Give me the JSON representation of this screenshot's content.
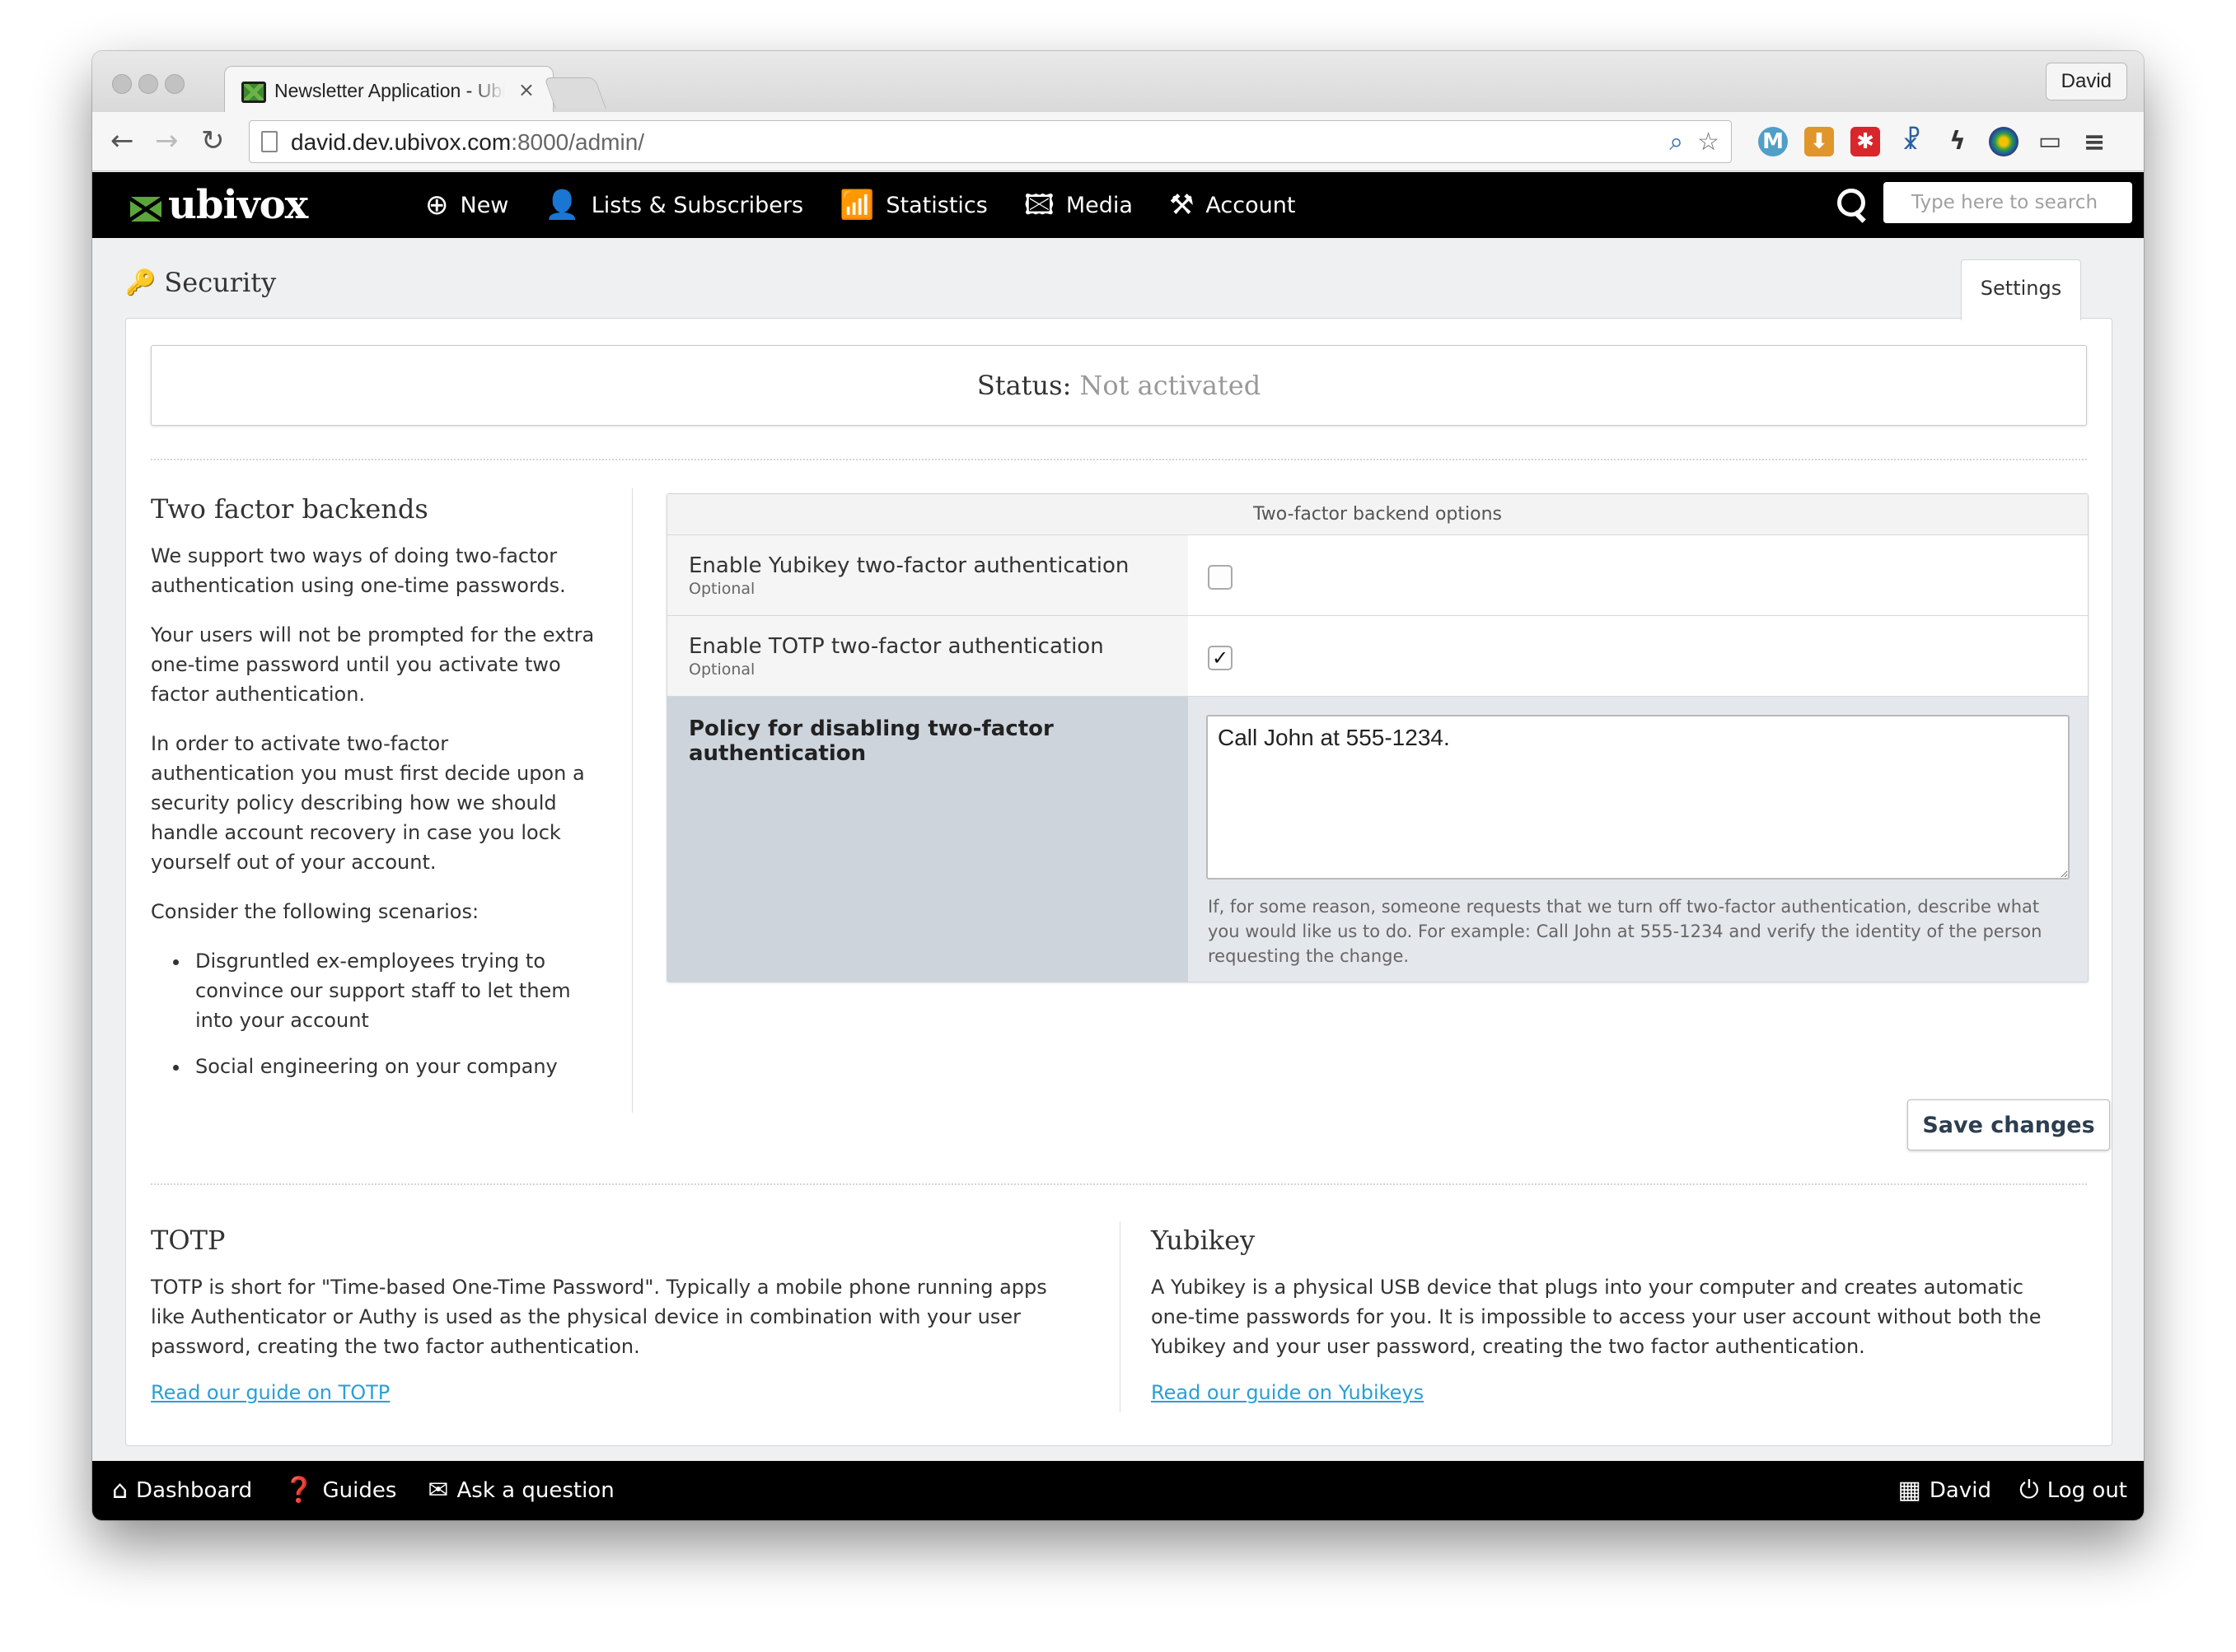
{
  "browser": {
    "tab_title": "Newsletter Application - Ubivox",
    "profile": "David",
    "url_host": "david.dev.ubivox.com",
    "url_rest": ":8000/admin/"
  },
  "nav": {
    "logo": "ubivox",
    "items": [
      {
        "label": "New",
        "icon": "plus-circle-icon"
      },
      {
        "label": "Lists & Subscribers",
        "icon": "users-icon"
      },
      {
        "label": "Statistics",
        "icon": "bar-chart-icon"
      },
      {
        "label": "Media",
        "icon": "images-icon"
      },
      {
        "label": "Account",
        "icon": "tools-icon"
      }
    ],
    "search_placeholder": "Type here to search"
  },
  "page": {
    "title": "Security",
    "tab_settings": "Settings",
    "status_label": "Status:",
    "status_value": "Not activated"
  },
  "backends": {
    "heading": "Two factor backends",
    "paragraphs": [
      "We support two ways of doing two-factor authentication using one-time passwords.",
      "Your users will not be prompted for the extra one-time password until you activate two factor authentication.",
      "In order to activate two-factor authentication you must first decide upon a security policy describing how we should handle account recovery in case you lock yourself out of your account.",
      "Consider the following scenarios:"
    ],
    "scenarios": [
      "Disgruntled ex-employees trying to convince our support staff to let them into your account",
      "Social engineering on your company"
    ]
  },
  "options": {
    "header": "Two-factor backend options",
    "yubikey_label": "Enable Yubikey two-factor authentication",
    "yubikey_hint": "Optional",
    "yubikey_checked": false,
    "totp_label": "Enable TOTP two-factor authentication",
    "totp_hint": "Optional",
    "totp_checked": true,
    "checkmark": "✓",
    "policy_label": "Policy for disabling two-factor authentication",
    "policy_value": "Call John at 555-1234.",
    "policy_help": "If, for some reason, someone requests that we turn off two-factor authentication, describe what you would like us to do. For example: Call John at 555-1234 and verify the identity of the person requesting the change.",
    "save_label": "Save changes"
  },
  "totp": {
    "heading": "TOTP",
    "text": "TOTP is short for \"Time-based One-Time Password\". Typically a mobile phone running apps like Authenticator or Authy is used as the physical device in combination with your user password, creating the two factor authentication.",
    "link": "Read our guide on TOTP"
  },
  "yubikey": {
    "heading": "Yubikey",
    "text": "A Yubikey is a physical USB device that plugs into your computer and creates automatic one-time passwords for you. It is impossible to access your user account without both the Yubikey and your user password, creating the two factor authentication.",
    "link": "Read our guide on Yubikeys"
  },
  "footer": {
    "left": [
      "Dashboard",
      "Guides",
      "Ask a question"
    ],
    "right": [
      "David",
      "Log out"
    ]
  },
  "colors": {
    "navbar": "#000000",
    "link": "#2a9fd6",
    "logo_green": "#5aa63b",
    "policy_label_bg": "#cdd4dc"
  }
}
